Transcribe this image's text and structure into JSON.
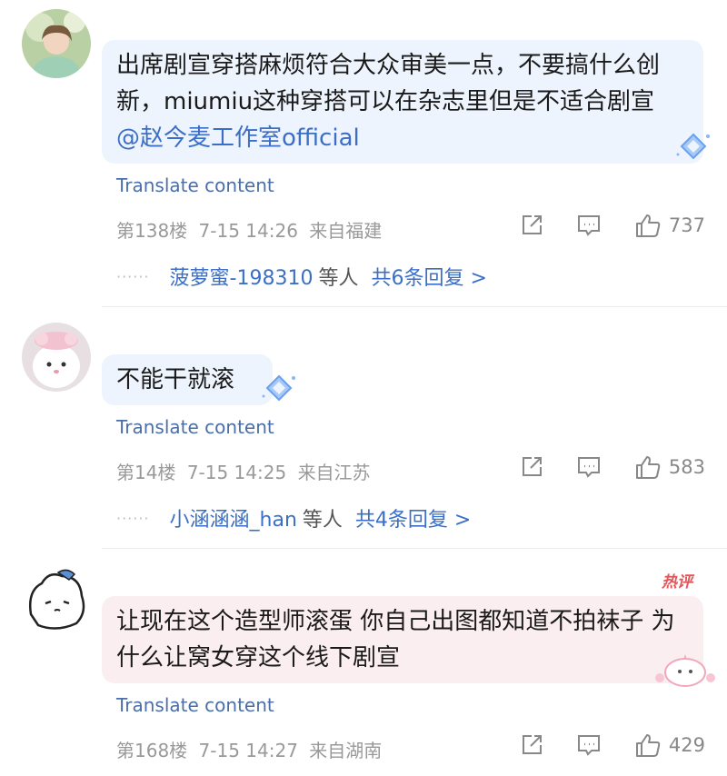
{
  "comments": [
    {
      "text": "出席剧宣穿搭麻烦符合大众审美一点，不要搞什么创新，miumiu这种穿搭可以在杂志里但是不适合剧宣",
      "line1": "出席剧宣穿搭麻烦符合大众审美一点，不要搞什么创",
      "line2": "新，miumiu这种穿搭可以在杂志里但是不适合剧宣",
      "mention": "@赵今麦工作室official",
      "translate": "Translate content",
      "floor": "第138楼",
      "time": "7-15 14:26",
      "location": "来自福建",
      "likes": "737",
      "reply_dots": "······",
      "reply_name": "菠萝蜜-198310",
      "reply_mid": "等人",
      "reply_total": "共6条回复 >"
    },
    {
      "text": "不能干就滚",
      "translate": "Translate content",
      "floor": "第14楼",
      "time": "7-15 14:25",
      "location": "来自江苏",
      "likes": "583",
      "reply_dots": "······",
      "reply_name": "小涵涵涵_han",
      "reply_mid": "等人",
      "reply_total": "共4条回复 >"
    },
    {
      "line1": "让现在这个造型师滚蛋 你自己出图都知道不拍袜子 为",
      "line2": "什么让窝女穿这个线下剧宣",
      "badge": "热评",
      "translate": "Translate content",
      "floor": "第168楼",
      "time": "7-15 14:27",
      "location": "来自湖南",
      "likes": "429"
    }
  ],
  "icons": {
    "share": "share-icon",
    "comment": "comment-icon",
    "like": "thumbs-up-icon",
    "gem": "diamond-gem-icon"
  },
  "colors": {
    "link": "#3b6fc7",
    "translate": "#4a6fa8",
    "meta": "#999999",
    "bubble_blue": "#eef4fd",
    "bubble_pink": "#fbeef0",
    "hot_badge": "#e0565b"
  }
}
